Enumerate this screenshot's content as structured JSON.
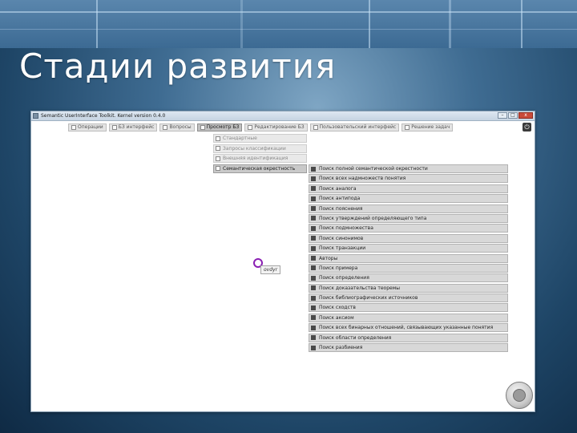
{
  "slide": {
    "title": "Стадии развития"
  },
  "window": {
    "title": "Semantic UserInterface Toolkit. Kernel version 0.4.0",
    "controls": {
      "minimize": "–",
      "maximize": "□",
      "close": "x"
    }
  },
  "tabs": [
    {
      "label": "Операции",
      "active": false
    },
    {
      "label": "БЗ интерфейс",
      "active": false
    },
    {
      "label": "Вопросы",
      "active": false
    },
    {
      "label": "Просмотр БЗ",
      "active": true
    },
    {
      "label": "Редактирование БЗ",
      "active": false
    },
    {
      "label": "Пользовательский интерфейс",
      "active": false
    },
    {
      "label": "Решение задач",
      "active": false
    }
  ],
  "submenu": [
    {
      "label": "Стандартные",
      "active": false
    },
    {
      "label": "Запросы классификации",
      "active": false
    },
    {
      "label": "Внешняя идентификация",
      "active": false
    },
    {
      "label": "Семантическая окрестность",
      "active": true
    }
  ],
  "results": [
    "Поиск полной семантической окрестности",
    "Поиск всех надмножеств понятия",
    "Поиск аналога",
    "Поиск антипода",
    "Поиск пояснения",
    "Поиск утверждений определяющего типа",
    "Поиск подмножества",
    "Поиск синонимов",
    "Поиск транзакции",
    "Авторы",
    "Поиск примера",
    "Поиск определения",
    "Поиск доказательства теоремы",
    "Поиск библиографических источников",
    "Поиск сходств",
    "Поиск аксиом",
    "Поиск всех бинарных отношений, связывающих указанные понятия",
    "Поиск области определения",
    "Поиск разбиения"
  ],
  "graph_node": {
    "label": "ovdyr"
  },
  "icons": {
    "tab_checkbox": "checkbox-icon",
    "result_icon": "command-icon",
    "power": "power-icon",
    "corner": "logo-icon"
  }
}
